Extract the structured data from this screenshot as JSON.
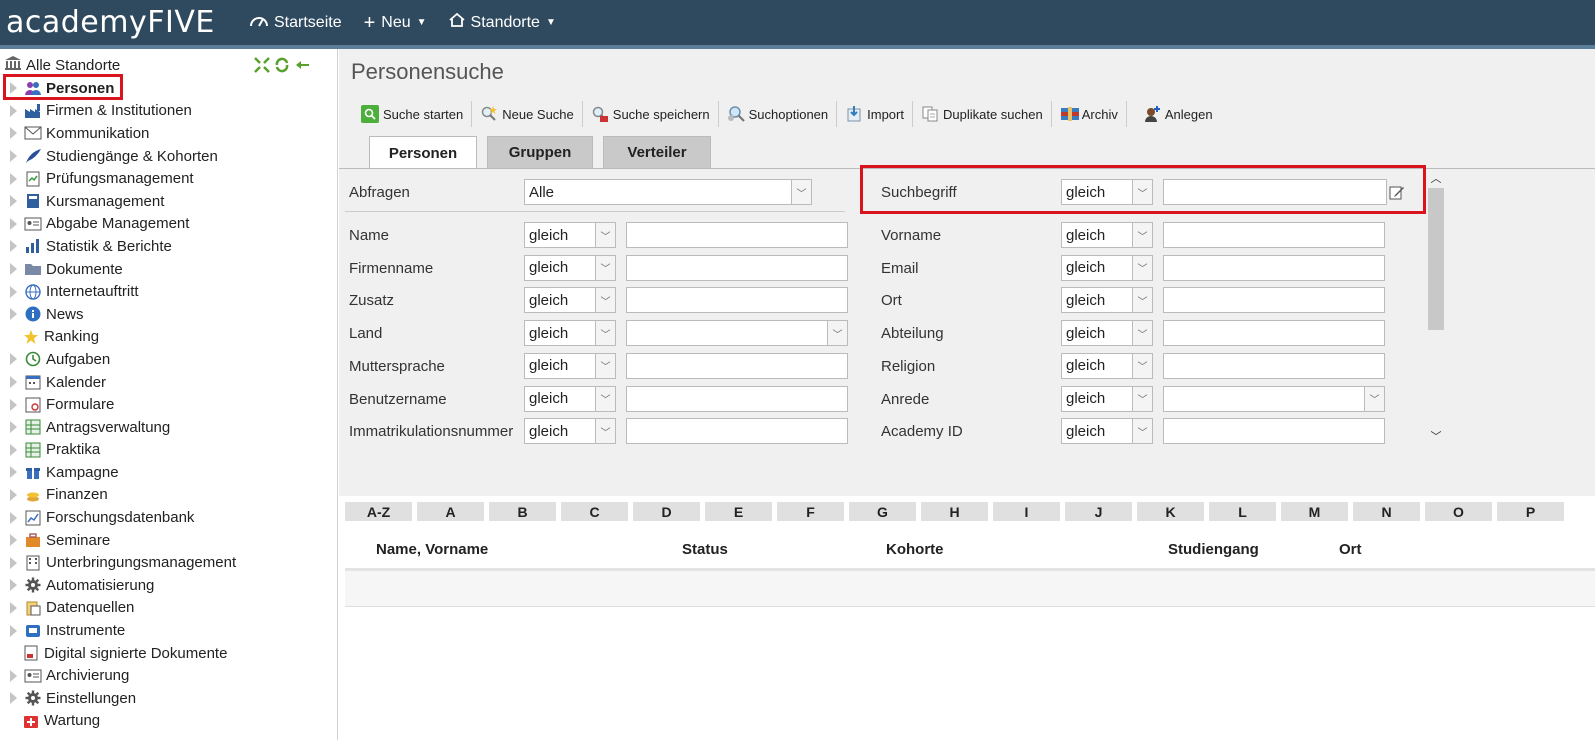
{
  "app": {
    "brand": "academyFIVE"
  },
  "topnav": {
    "items": [
      {
        "label": "Startseite",
        "icon": "dashboard-icon"
      },
      {
        "label": "Neu",
        "icon": "plus-icon",
        "caret": true
      },
      {
        "label": "Standorte",
        "icon": "home-icon",
        "caret": true
      }
    ]
  },
  "sidebar": {
    "root": "Alle Standorte",
    "items": [
      {
        "label": "Personen",
        "icon": "people-icon",
        "selected": true,
        "expandable": true
      },
      {
        "label": "Firmen & Institutionen",
        "icon": "factory-icon",
        "expandable": true
      },
      {
        "label": "Kommunikation",
        "icon": "envelope-icon",
        "expandable": true
      },
      {
        "label": "Studiengänge & Kohorten",
        "icon": "feather-icon",
        "expandable": true
      },
      {
        "label": "Prüfungsmanagement",
        "icon": "exam-icon",
        "expandable": true
      },
      {
        "label": "Kursmanagement",
        "icon": "book-icon",
        "expandable": true
      },
      {
        "label": "Abgabe Management",
        "icon": "idcard-icon",
        "expandable": true
      },
      {
        "label": "Statistik & Berichte",
        "icon": "barchart-icon",
        "expandable": true
      },
      {
        "label": "Dokumente",
        "icon": "folder-icon",
        "expandable": true
      },
      {
        "label": "Internetauftritt",
        "icon": "globe-icon",
        "expandable": true
      },
      {
        "label": "News",
        "icon": "info-icon",
        "expandable": true
      },
      {
        "label": "Ranking",
        "icon": "star-icon",
        "expandable": false
      },
      {
        "label": "Aufgaben",
        "icon": "history-icon",
        "expandable": true
      },
      {
        "label": "Kalender",
        "icon": "calendar-icon",
        "expandable": true
      },
      {
        "label": "Formulare",
        "icon": "form-icon",
        "expandable": true
      },
      {
        "label": "Antragsverwaltung",
        "icon": "table-icon",
        "expandable": true
      },
      {
        "label": "Praktika",
        "icon": "table-icon",
        "expandable": true
      },
      {
        "label": "Kampagne",
        "icon": "gift-icon",
        "expandable": true
      },
      {
        "label": "Finanzen",
        "icon": "coins-icon",
        "expandable": true
      },
      {
        "label": "Forschungsdatenbank",
        "icon": "linechart-icon",
        "expandable": true
      },
      {
        "label": "Seminare",
        "icon": "briefcase-icon",
        "expandable": true
      },
      {
        "label": "Unterbringungsmanagement",
        "icon": "building-icon",
        "expandable": true
      },
      {
        "label": "Automatisierung",
        "icon": "gear-icon",
        "expandable": true
      },
      {
        "label": "Datenquellen",
        "icon": "database-icon",
        "expandable": true
      },
      {
        "label": "Instrumente",
        "icon": "instrument-icon",
        "expandable": true
      },
      {
        "label": "Digital signierte Dokumente",
        "icon": "signed-doc-icon",
        "expandable": false
      },
      {
        "label": "Archivierung",
        "icon": "idcard-icon",
        "expandable": true
      },
      {
        "label": "Einstellungen",
        "icon": "gear-icon",
        "expandable": true
      },
      {
        "label": "Wartung",
        "icon": "firstaid-icon",
        "expandable": false
      }
    ]
  },
  "main": {
    "title": "Personensuche",
    "toolbar": [
      {
        "label": "Suche starten",
        "icon": "search-icon"
      },
      {
        "label": "Neue Suche",
        "icon": "new-search-icon"
      },
      {
        "label": "Suche speichern",
        "icon": "save-search-icon"
      },
      {
        "label": "Suchoptionen",
        "icon": "search-options-icon"
      },
      {
        "label": "Import",
        "icon": "import-icon"
      },
      {
        "label": "Duplikate suchen",
        "icon": "duplicate-icon"
      },
      {
        "label": "Archiv",
        "icon": "archive-icon"
      },
      {
        "label": "Anlegen",
        "icon": "add-person-icon"
      }
    ],
    "tabs": [
      {
        "label": "Personen",
        "active": true
      },
      {
        "label": "Gruppen",
        "active": false
      },
      {
        "label": "Verteiler",
        "active": false
      }
    ],
    "form": {
      "abfragen_label": "Abfragen",
      "abfragen_value": "Alle",
      "suchbegriff_label": "Suchbegriff",
      "operator": "gleich",
      "left_fields": [
        "Name",
        "Firmenname",
        "Zusatz",
        "Land",
        "Muttersprache",
        "Benutzername",
        "Immatrikulationsnummer"
      ],
      "right_fields": [
        "Vorname",
        "Email",
        "Ort",
        "Abteilung",
        "Religion",
        "Anrede",
        "Academy ID"
      ]
    },
    "alphabet": [
      "A-Z",
      "A",
      "B",
      "C",
      "D",
      "E",
      "F",
      "G",
      "H",
      "I",
      "J",
      "K",
      "L",
      "M",
      "N",
      "O",
      "P"
    ],
    "grid": {
      "columns": [
        "Name, Vorname",
        "Status",
        "Kohorte",
        "Studiengang",
        "Ort"
      ]
    }
  }
}
